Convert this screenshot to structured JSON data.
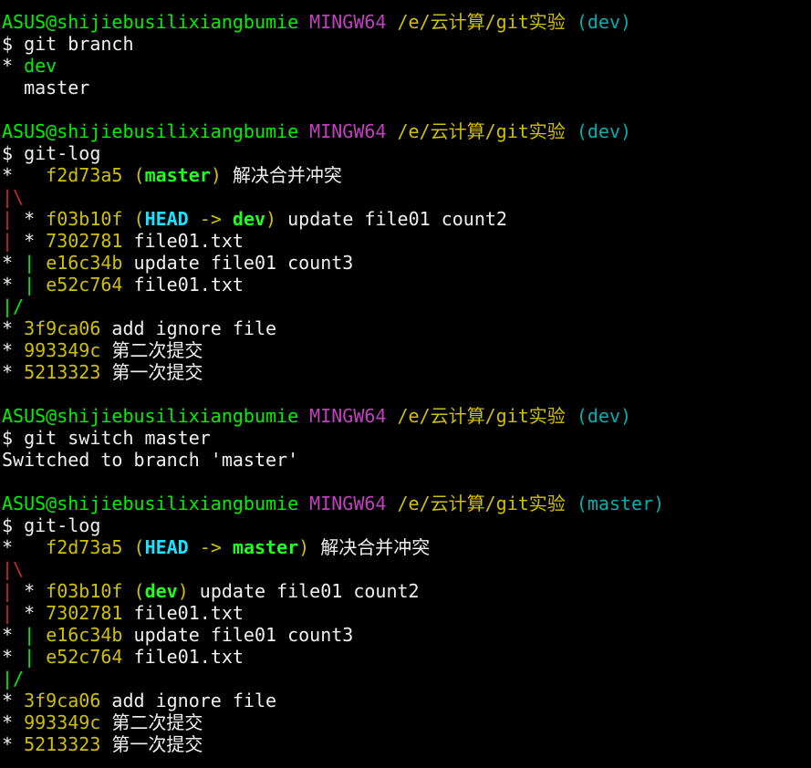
{
  "terminal": {
    "lines": [
      [
        {
          "t": "ASUS@shijiebusilixiangbumie",
          "c": "green"
        },
        {
          "t": " ",
          "c": "white"
        },
        {
          "t": "MINGW64",
          "c": "magenta"
        },
        {
          "t": " ",
          "c": "white"
        },
        {
          "t": "/e/云计算/git实验",
          "c": "yellow"
        },
        {
          "t": " ",
          "c": "white"
        },
        {
          "t": "(dev)",
          "c": "cyan"
        }
      ],
      [
        {
          "t": "$ git branch",
          "c": "white"
        }
      ],
      [
        {
          "t": "* ",
          "c": "white"
        },
        {
          "t": "dev",
          "c": "green"
        }
      ],
      [
        {
          "t": "  master",
          "c": "white"
        }
      ],
      [],
      [
        {
          "t": "ASUS@shijiebusilixiangbumie",
          "c": "green"
        },
        {
          "t": " ",
          "c": "white"
        },
        {
          "t": "MINGW64",
          "c": "magenta"
        },
        {
          "t": " ",
          "c": "white"
        },
        {
          "t": "/e/云计算/git实验",
          "c": "yellow"
        },
        {
          "t": " ",
          "c": "white"
        },
        {
          "t": "(dev)",
          "c": "cyan"
        }
      ],
      [
        {
          "t": "$ git-log",
          "c": "white"
        }
      ],
      [
        {
          "t": "*   ",
          "c": "white"
        },
        {
          "t": "f2d73a5",
          "c": "yellow"
        },
        {
          "t": " ",
          "c": "white"
        },
        {
          "t": "(",
          "c": "yellow"
        },
        {
          "t": "master",
          "c": "bgreen"
        },
        {
          "t": ")",
          "c": "yellow"
        },
        {
          "t": " 解决合并冲突",
          "c": "white"
        }
      ],
      [
        {
          "t": "|\\",
          "c": "red"
        }
      ],
      [
        {
          "t": "|",
          "c": "red"
        },
        {
          "t": " * ",
          "c": "white"
        },
        {
          "t": "f03b10f",
          "c": "yellow"
        },
        {
          "t": " ",
          "c": "white"
        },
        {
          "t": "(",
          "c": "yellow"
        },
        {
          "t": "HEAD",
          "c": "bcyan"
        },
        {
          "t": " -> ",
          "c": "yellow"
        },
        {
          "t": "dev",
          "c": "bgreen"
        },
        {
          "t": ")",
          "c": "yellow"
        },
        {
          "t": " update file01 count2",
          "c": "white"
        }
      ],
      [
        {
          "t": "|",
          "c": "red"
        },
        {
          "t": " * ",
          "c": "white"
        },
        {
          "t": "7302781",
          "c": "yellow"
        },
        {
          "t": " file01.txt",
          "c": "white"
        }
      ],
      [
        {
          "t": "* ",
          "c": "white"
        },
        {
          "t": "|",
          "c": "green"
        },
        {
          "t": " ",
          "c": "white"
        },
        {
          "t": "e16c34b",
          "c": "yellow"
        },
        {
          "t": " update file01 count3",
          "c": "white"
        }
      ],
      [
        {
          "t": "* ",
          "c": "white"
        },
        {
          "t": "|",
          "c": "green"
        },
        {
          "t": " ",
          "c": "white"
        },
        {
          "t": "e52c764",
          "c": "yellow"
        },
        {
          "t": " file01.txt",
          "c": "white"
        }
      ],
      [
        {
          "t": "|/",
          "c": "green"
        }
      ],
      [
        {
          "t": "* ",
          "c": "white"
        },
        {
          "t": "3f9ca06",
          "c": "yellow"
        },
        {
          "t": " add ignore file",
          "c": "white"
        }
      ],
      [
        {
          "t": "* ",
          "c": "white"
        },
        {
          "t": "993349c",
          "c": "yellow"
        },
        {
          "t": " 第二次提交",
          "c": "white"
        }
      ],
      [
        {
          "t": "* ",
          "c": "white"
        },
        {
          "t": "5213323",
          "c": "yellow"
        },
        {
          "t": " 第一次提交",
          "c": "white"
        }
      ],
      [],
      [
        {
          "t": "ASUS@shijiebusilixiangbumie",
          "c": "green"
        },
        {
          "t": " ",
          "c": "white"
        },
        {
          "t": "MINGW64",
          "c": "magenta"
        },
        {
          "t": " ",
          "c": "white"
        },
        {
          "t": "/e/云计算/git实验",
          "c": "yellow"
        },
        {
          "t": " ",
          "c": "white"
        },
        {
          "t": "(dev)",
          "c": "cyan"
        }
      ],
      [
        {
          "t": "$ git switch master",
          "c": "white"
        }
      ],
      [
        {
          "t": "Switched to branch 'master'",
          "c": "white"
        }
      ],
      [],
      [
        {
          "t": "ASUS@shijiebusilixiangbumie",
          "c": "green"
        },
        {
          "t": " ",
          "c": "white"
        },
        {
          "t": "MINGW64",
          "c": "magenta"
        },
        {
          "t": " ",
          "c": "white"
        },
        {
          "t": "/e/云计算/git实验",
          "c": "yellow"
        },
        {
          "t": " ",
          "c": "white"
        },
        {
          "t": "(master)",
          "c": "cyan"
        }
      ],
      [
        {
          "t": "$ git-log",
          "c": "white"
        }
      ],
      [
        {
          "t": "*   ",
          "c": "white"
        },
        {
          "t": "f2d73a5",
          "c": "yellow"
        },
        {
          "t": " ",
          "c": "white"
        },
        {
          "t": "(",
          "c": "yellow"
        },
        {
          "t": "HEAD",
          "c": "bcyan"
        },
        {
          "t": " -> ",
          "c": "yellow"
        },
        {
          "t": "master",
          "c": "bgreen"
        },
        {
          "t": ")",
          "c": "yellow"
        },
        {
          "t": " 解决合并冲突",
          "c": "white"
        }
      ],
      [
        {
          "t": "|\\",
          "c": "red"
        }
      ],
      [
        {
          "t": "|",
          "c": "red"
        },
        {
          "t": " * ",
          "c": "white"
        },
        {
          "t": "f03b10f",
          "c": "yellow"
        },
        {
          "t": " ",
          "c": "white"
        },
        {
          "t": "(",
          "c": "yellow"
        },
        {
          "t": "dev",
          "c": "bgreen"
        },
        {
          "t": ")",
          "c": "yellow"
        },
        {
          "t": " update file01 count2",
          "c": "white"
        }
      ],
      [
        {
          "t": "|",
          "c": "red"
        },
        {
          "t": " * ",
          "c": "white"
        },
        {
          "t": "7302781",
          "c": "yellow"
        },
        {
          "t": " file01.txt",
          "c": "white"
        }
      ],
      [
        {
          "t": "* ",
          "c": "white"
        },
        {
          "t": "|",
          "c": "green"
        },
        {
          "t": " ",
          "c": "white"
        },
        {
          "t": "e16c34b",
          "c": "yellow"
        },
        {
          "t": " update file01 count3",
          "c": "white"
        }
      ],
      [
        {
          "t": "* ",
          "c": "white"
        },
        {
          "t": "|",
          "c": "green"
        },
        {
          "t": " ",
          "c": "white"
        },
        {
          "t": "e52c764",
          "c": "yellow"
        },
        {
          "t": " file01.txt",
          "c": "white"
        }
      ],
      [
        {
          "t": "|/",
          "c": "green"
        }
      ],
      [
        {
          "t": "* ",
          "c": "white"
        },
        {
          "t": "3f9ca06",
          "c": "yellow"
        },
        {
          "t": " add ignore file",
          "c": "white"
        }
      ],
      [
        {
          "t": "* ",
          "c": "white"
        },
        {
          "t": "993349c",
          "c": "yellow"
        },
        {
          "t": " 第二次提交",
          "c": "white"
        }
      ],
      [
        {
          "t": "* ",
          "c": "white"
        },
        {
          "t": "5213323",
          "c": "yellow"
        },
        {
          "t": " 第一次提交",
          "c": "white"
        }
      ]
    ]
  },
  "colors": {
    "background": "#000000",
    "prompt_user": "#00f000",
    "prompt_system": "#c040c0",
    "prompt_path": "#cfc000",
    "prompt_branch": "#00b0b0",
    "commit_hash": "#cfc000",
    "graph_red": "#c82828",
    "graph_green": "#00f000",
    "ref_branch": "#20ff20",
    "ref_head": "#20e0ff",
    "text": "#f0f0f0"
  }
}
